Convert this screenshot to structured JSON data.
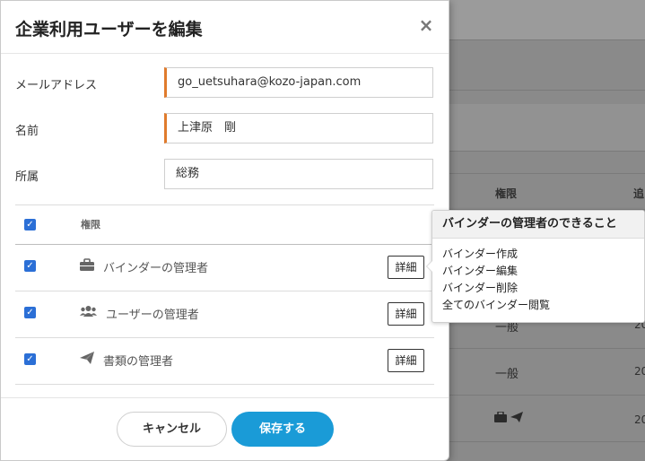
{
  "modal": {
    "title": "企業利用ユーザーを編集",
    "close_icon": "close-icon",
    "fields": {
      "email": {
        "label": "メールアドレス",
        "value": "go_uetsuhara@kozo-japan.com",
        "required": true
      },
      "name": {
        "label": "名前",
        "value": "上津原　剛",
        "required": true
      },
      "department": {
        "label": "所属",
        "value": "総務",
        "required": false
      }
    },
    "permissions": {
      "header": "権限",
      "all_checked": true,
      "rows": [
        {
          "label": "バインダーの管理者",
          "icon": "briefcase-icon",
          "checked": true,
          "detail_label": "詳細"
        },
        {
          "label": "ユーザーの管理者",
          "icon": "users-icon",
          "checked": true,
          "detail_label": "詳細"
        },
        {
          "label": "書類の管理者",
          "icon": "paper-plane-icon",
          "checked": true,
          "detail_label": "詳細"
        }
      ]
    },
    "footer": {
      "cancel_label": "キャンセル",
      "save_label": "保存する"
    }
  },
  "popover": {
    "title": "バインダーの管理者のできること",
    "items": [
      "バインダー作成",
      "バインダー編集",
      "バインダー削除",
      "全てのバインダー閲覧"
    ]
  },
  "background": {
    "header_perm": "権限",
    "header_partial": "追",
    "cells": [
      "一般",
      "一般"
    ],
    "partial_nums": [
      "20",
      "20",
      "20",
      "20",
      "20"
    ]
  },
  "colors": {
    "accent": "#1a9bd7",
    "required_marker": "#e07b2c",
    "checkbox": "#2b6fd6"
  }
}
